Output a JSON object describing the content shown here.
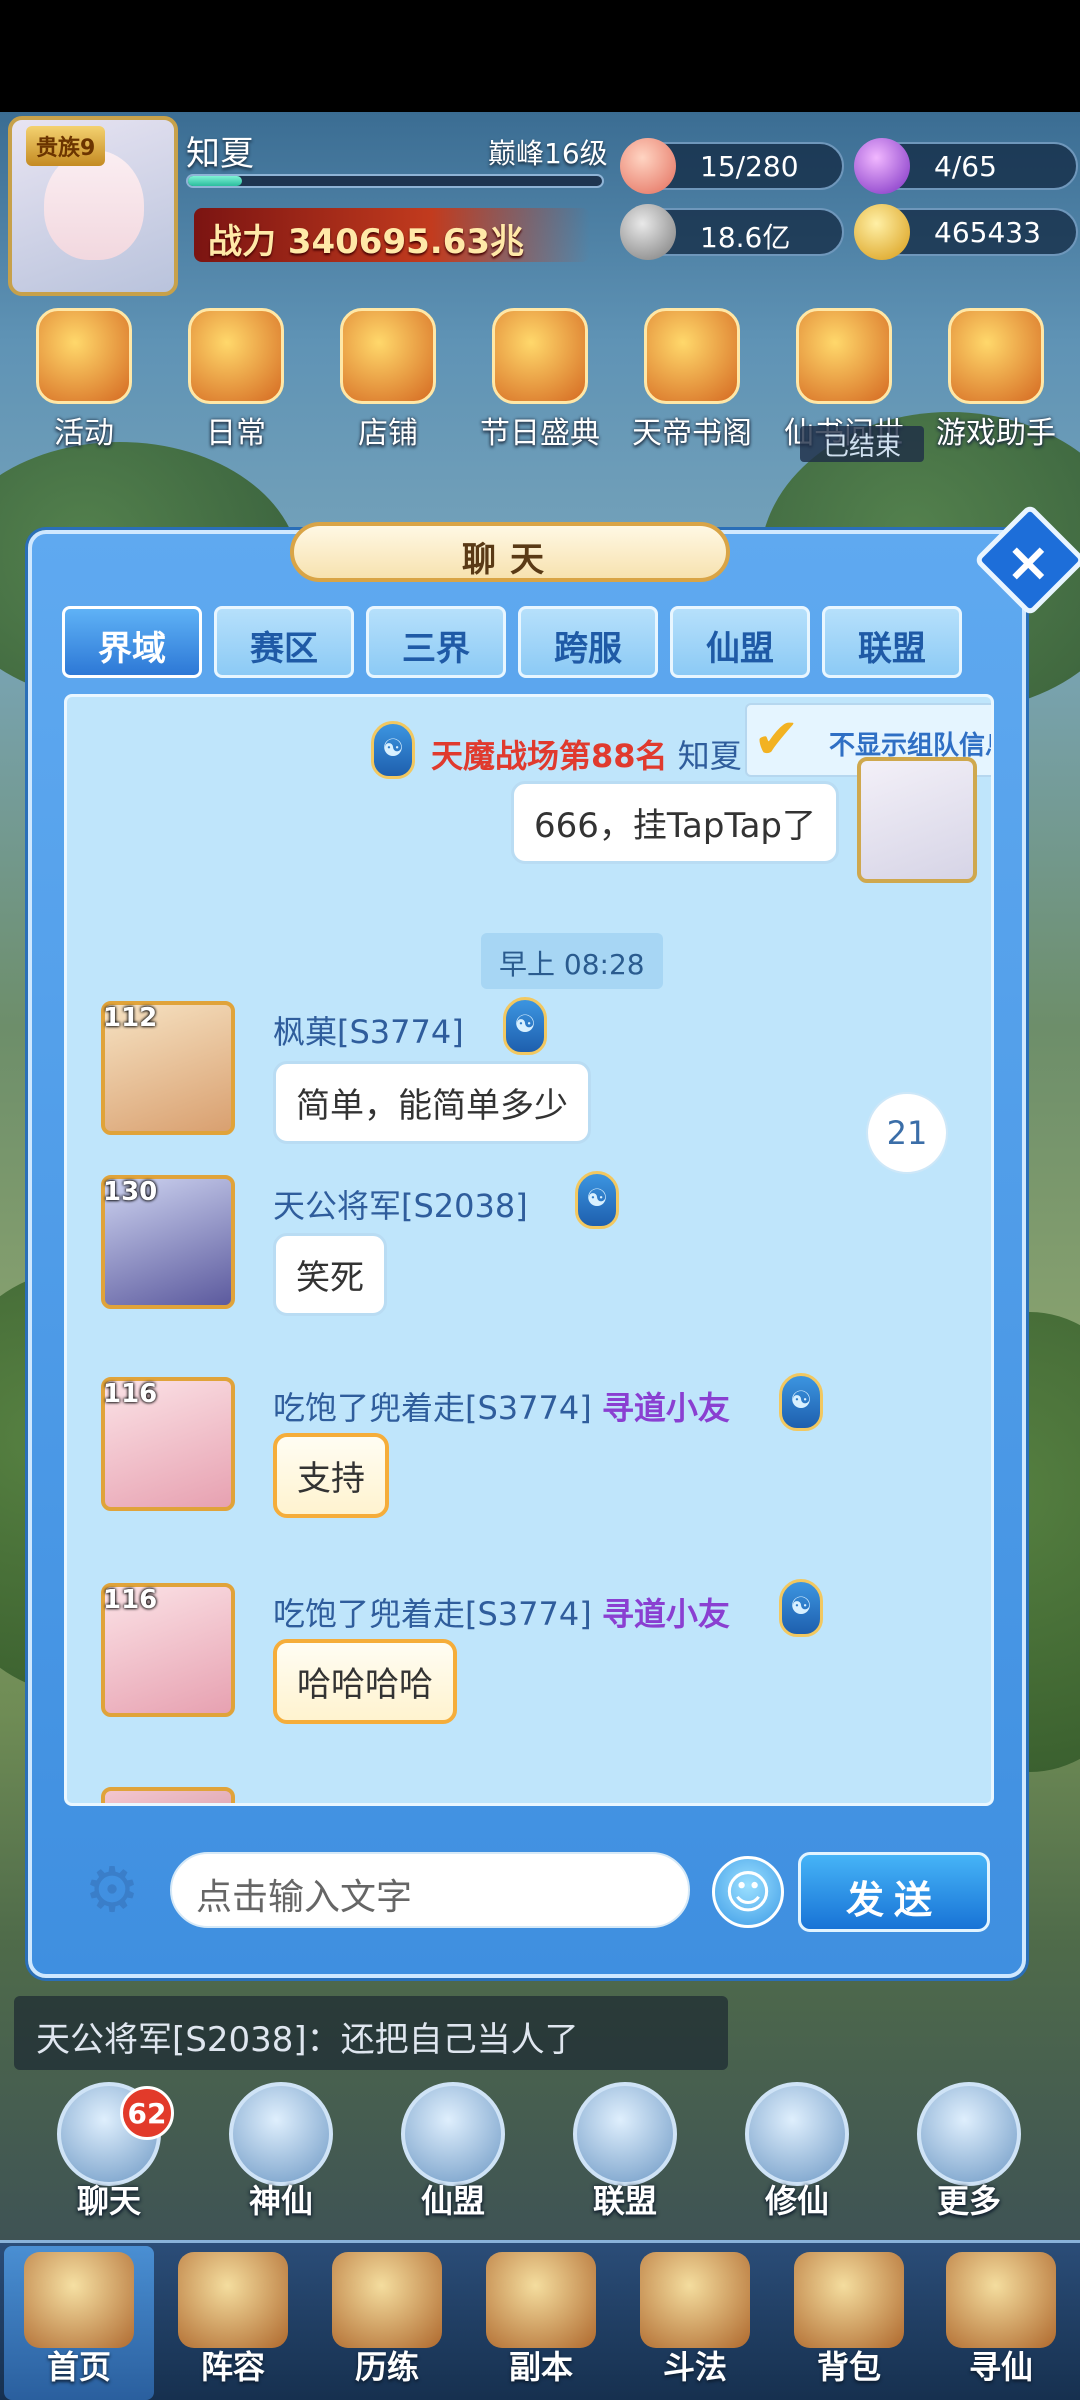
{
  "player": {
    "noble_label": "贵族9",
    "name": "知夏",
    "rank": "巅峰16级",
    "power": "战力 340695.63兆",
    "exp_fraction": 0.13,
    "resources": [
      {
        "icon": "peach-icon",
        "value": "15/280"
      },
      {
        "icon": "spirit-flame-icon",
        "value": "4/65"
      },
      {
        "icon": "coin-icon",
        "value": "18.6亿"
      },
      {
        "icon": "gold-ingot-icon",
        "value": "465433"
      }
    ]
  },
  "features": [
    {
      "icon": "activity-drum-icon",
      "label": "活动"
    },
    {
      "icon": "daily-scroll-icon",
      "label": "日常"
    },
    {
      "icon": "shop-icon",
      "label": "店铺"
    },
    {
      "icon": "gift-box-icon",
      "label": "节日盛典"
    },
    {
      "icon": "book-icon",
      "label": "天帝书阁"
    },
    {
      "icon": "fairy-book-icon",
      "label": "仙书问世"
    },
    {
      "icon": "helper-fox-icon",
      "label": "游戏助手"
    }
  ],
  "ended_label": "已结束",
  "chat": {
    "title": "聊天",
    "tabs": [
      "界域",
      "赛区",
      "三界",
      "跨服",
      "仙盟",
      "联盟"
    ],
    "active_tab": 0,
    "hide_team_info_label": "不显示组队信息",
    "self_message": {
      "title": "天魔战场第88名",
      "name": "知夏",
      "text": "666，挂TapTap了"
    },
    "timestamp": "早上 08:28",
    "messages": [
      {
        "level": "112",
        "name": "枫菓[S3774]",
        "title": "",
        "text": "简单，能简单多少",
        "style": "plain"
      },
      {
        "level": "130",
        "name": "天公将军[S2038]",
        "title": "",
        "text": "笑死",
        "style": "plain"
      },
      {
        "level": "116",
        "name": "吃饱了兜着走[S3774]",
        "title": "寻道小友",
        "text": "支持",
        "style": "gold"
      },
      {
        "level": "116",
        "name": "吃饱了兜着走[S3774]",
        "title": "寻道小友",
        "text": "哈哈哈哈",
        "style": "gold"
      }
    ],
    "unread_count": "21",
    "input_placeholder": "点击输入文字",
    "send_label": "发送"
  },
  "ticker": "天公将军[S2038]：还把自己当人了",
  "shortcuts": [
    {
      "icon": "chat-bubble-icon",
      "label": "聊天"
    },
    {
      "icon": "immortal-icon",
      "label": "神仙"
    },
    {
      "icon": "alliance-scroll-icon",
      "label": "仙盟"
    },
    {
      "icon": "league-banner-icon",
      "label": "联盟"
    },
    {
      "icon": "crane-icon",
      "label": "修仙"
    },
    {
      "icon": "more-flower-icon",
      "label": "更多"
    }
  ],
  "chat_badge": "62",
  "bottom_nav": [
    {
      "icon": "home-mountain-icon",
      "label": "首页"
    },
    {
      "icon": "lineup-cards-icon",
      "label": "阵容"
    },
    {
      "icon": "training-gourd-icon",
      "label": "历练"
    },
    {
      "icon": "dungeon-gate-icon",
      "label": "副本"
    },
    {
      "icon": "duel-icon",
      "label": "斗法"
    },
    {
      "icon": "backpack-icon",
      "label": "背包"
    },
    {
      "icon": "seek-immortal-icon",
      "label": "寻仙"
    }
  ],
  "bottom_nav_active": 0
}
